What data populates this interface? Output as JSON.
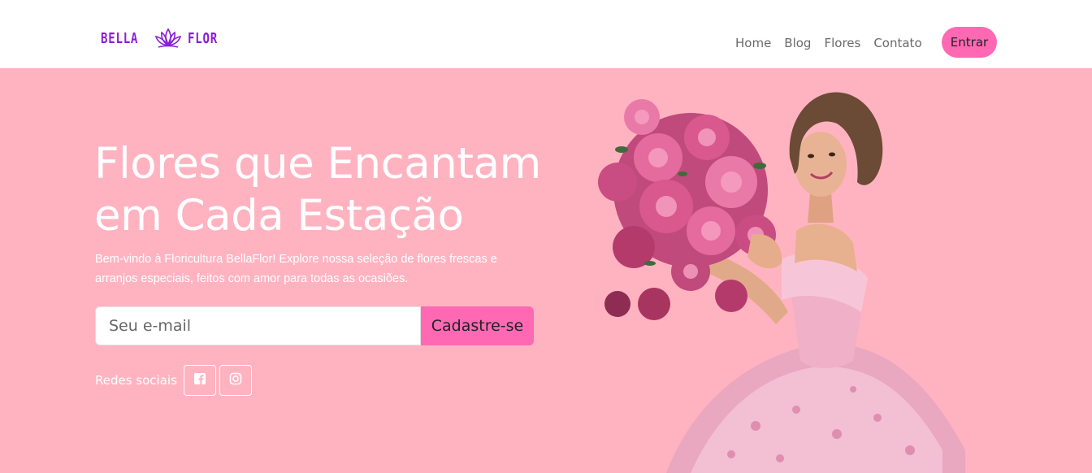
{
  "stray_char": "<",
  "brand": {
    "left_word": "BELLA",
    "right_word": "FLOR",
    "color": "#8a1ed8"
  },
  "nav": {
    "items": [
      "Home",
      "Blog",
      "Flores",
      "Contato"
    ]
  },
  "header": {
    "enter_label": "Entrar"
  },
  "hero": {
    "title_line1": "Flores que Encantam",
    "title_line2": "em Cada Estação",
    "description": "Bem-vindo à Floricultura BellaFlor! Explore nossa seleção de flores frescas e arranjos especiais, feitos com amor para todas as ocasiões.",
    "email_placeholder": "Seu e-mail",
    "signup_label": "Cadastre-se",
    "social_label": "Redes sociais"
  },
  "icons": {
    "logo": "lotus-icon",
    "facebook": "facebook-icon",
    "instagram": "instagram-icon"
  },
  "colors": {
    "hero_bg": "#ffb3c1",
    "accent": "#ff69b4",
    "brand": "#8a1ed8"
  }
}
